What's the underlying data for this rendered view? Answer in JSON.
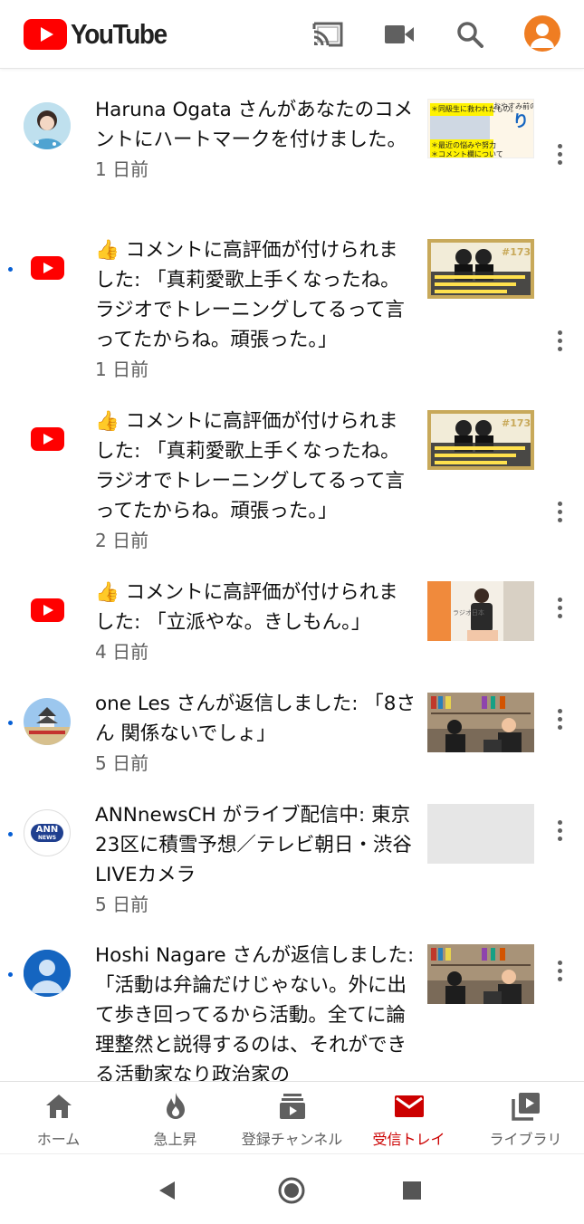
{
  "header": {
    "logo_text": "YouTube",
    "brand_color": "#ff0000",
    "icons": [
      "cast-icon",
      "video-camera-icon",
      "search-icon",
      "account-avatar"
    ]
  },
  "notifications": [
    {
      "text": "Haruna Ogata さんがあなたのコメントにハートマークを付けました。",
      "time": "1 日前",
      "unread": false,
      "lead": "avatar-photo",
      "thumb_text": [
        "おやすみ前の",
        "お喋り",
        "＊同級生に救われたもの。",
        "＊最近の悩みや努力",
        "＊コメント欄について"
      ]
    },
    {
      "text": "👍 コメントに高評価が付けられました: 「真莉愛歌上手くなったね。ラジオでトレーニングしてるって言ってたからね。頑張った。」",
      "time": "1 日前",
      "unread": true,
      "lead": "youtube-logo",
      "thumb_text": [
        "#173"
      ]
    },
    {
      "text": "👍 コメントに高評価が付けられました: 「真莉愛歌上手くなったね。ラジオでトレーニングしてるって言ってたからね。頑張った。」",
      "time": "2 日前",
      "unread": false,
      "lead": "youtube-logo",
      "thumb_text": [
        "#173"
      ]
    },
    {
      "text": "👍 コメントに高評価が付けられました: 「立派やな。きしもん。」",
      "time": "4 日前",
      "unread": false,
      "lead": "youtube-logo",
      "thumb_text": [
        "ラジオ日本"
      ]
    },
    {
      "text": "one Les さんが返信しました: 「8さん 関係ないでしょ」",
      "time": "5 日前",
      "unread": true,
      "lead": "avatar-photo",
      "thumb_text": []
    },
    {
      "text": "ANNnewsCH がライブ配信中: 東京23区に積雪予想／テレビ朝日・渋谷LIVEカメラ",
      "time": "5 日前",
      "unread": true,
      "lead": "ann-logo",
      "lead_text": [
        "ANN",
        "NEWS"
      ],
      "thumb_text": []
    },
    {
      "text": "Hoshi Nagare さんが返信しました: 「活動は弁論だけじゃない。外に出て歩き回ってるから活動。全てに論理整然と説得するのは、それができる活動家なり政治家の",
      "time": "",
      "unread": true,
      "lead": "default-avatar",
      "thumb_text": []
    }
  ],
  "bottom_nav": [
    {
      "label": "ホーム",
      "icon": "home-icon",
      "active": false
    },
    {
      "label": "急上昇",
      "icon": "trending-flame-icon",
      "active": false
    },
    {
      "label": "登録チャンネル",
      "icon": "subscriptions-icon",
      "active": false
    },
    {
      "label": "受信トレイ",
      "icon": "inbox-mail-icon",
      "active": true
    },
    {
      "label": "ライブラリ",
      "icon": "library-icon",
      "active": false
    }
  ],
  "colors": {
    "active_tab": "#cc0000",
    "unread_dot": "#065fd4",
    "secondary_text": "#606060",
    "avatar_orange": "#ef7d22"
  }
}
